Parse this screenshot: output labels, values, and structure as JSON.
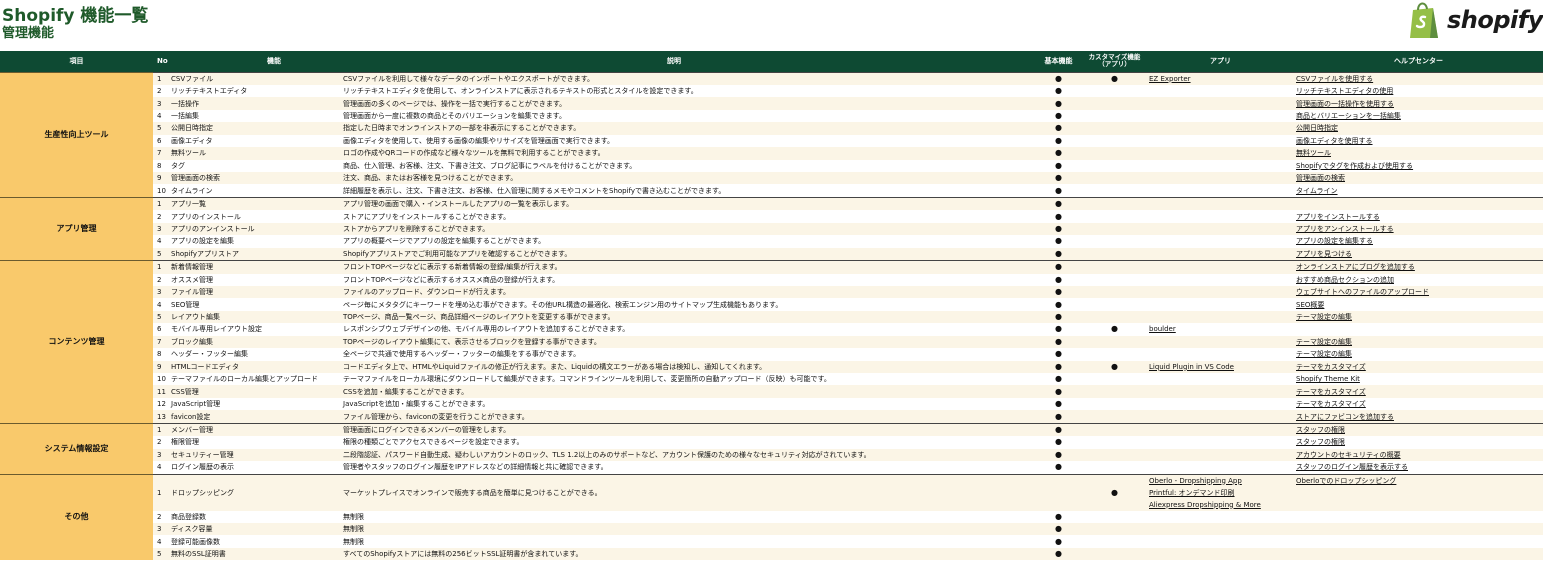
{
  "title": "Shopify 機能一覧",
  "subtitle": "管理機能",
  "logo_text": "shopify",
  "colors": {
    "header_bg": "#0e4a33",
    "category_bg": "#f9c96b",
    "row_alt": "#fbf5e6",
    "title": "#1f5a2a",
    "logo_green": "#95bf47"
  },
  "headers": {
    "category": "項目",
    "no": "No",
    "feature": "機能",
    "description": "説明",
    "basic": "基本機能",
    "custom": "カスタマイズ機能（アプリ）",
    "app": "アプリ",
    "help": "ヘルプセンター"
  },
  "dot": "●",
  "sections": [
    {
      "category": "生産性向上ツール",
      "rows": [
        {
          "no": "1",
          "feature": "CSVファイル",
          "desc": "CSVファイルを利用して様々なデータのインポートやエクスポートができます。",
          "basic": true,
          "custom": true,
          "apps": [
            "EZ Exporter"
          ],
          "help": "CSVファイルを使用する"
        },
        {
          "no": "2",
          "feature": "リッチテキストエディタ",
          "desc": "リッチテキストエディタを使用して、オンラインストアに表示されるテキストの形式とスタイルを設定できます。",
          "basic": true,
          "custom": false,
          "apps": [],
          "help": "リッチテキストエディタの使用"
        },
        {
          "no": "3",
          "feature": "一括操作",
          "desc": "管理画面の多くのページでは、操作を一括で実行することができます。",
          "basic": true,
          "custom": false,
          "apps": [],
          "help": "管理画面の一括操作を使用する"
        },
        {
          "no": "4",
          "feature": "一括編集",
          "desc": "管理画面から一度に複数の商品とそのバリエーションを編集できます。",
          "basic": true,
          "custom": false,
          "apps": [],
          "help": "商品とバリエーションを一括編集"
        },
        {
          "no": "5",
          "feature": "公開日時指定",
          "desc": "指定した日時までオンラインストアの一部を非表示にすることができます。",
          "basic": true,
          "custom": false,
          "apps": [],
          "help": "公開日時指定"
        },
        {
          "no": "6",
          "feature": "画像エディタ",
          "desc": "画像エディタを使用して、使用する画像の編集やリサイズを管理画面で実行できます。",
          "basic": true,
          "custom": false,
          "apps": [],
          "help": "画像エディタを使用する"
        },
        {
          "no": "7",
          "feature": "無料ツール",
          "desc": "ロゴの作成やQRコードの作成など様々なツールを無料で利用することができます。",
          "basic": true,
          "custom": false,
          "apps": [],
          "help": "無料ツール"
        },
        {
          "no": "8",
          "feature": "タグ",
          "desc": "商品、仕入管理、お客様、注文、下書き注文、ブログ記事にラベルを付けることができます。",
          "basic": true,
          "custom": false,
          "apps": [],
          "help": "Shopifyでタグを作成および使用する"
        },
        {
          "no": "9",
          "feature": "管理画面の検索",
          "desc": "注文、商品、またはお客様を見つけることができます。",
          "basic": true,
          "custom": false,
          "apps": [],
          "help": "管理画面の検索"
        },
        {
          "no": "10",
          "feature": "タイムライン",
          "desc": "詳細履歴を表示し、注文、下書き注文、お客様、仕入管理に関するメモやコメントをShopifyで書き込むことができます。",
          "basic": true,
          "custom": false,
          "apps": [],
          "help": "タイムライン"
        }
      ]
    },
    {
      "category": "アプリ管理",
      "rows": [
        {
          "no": "1",
          "feature": "アプリ一覧",
          "desc": "アプリ管理の画面で購入・インストールしたアプリの一覧を表示します。",
          "basic": true,
          "custom": false,
          "apps": [],
          "help": ""
        },
        {
          "no": "2",
          "feature": "アプリのインストール",
          "desc": "ストアにアプリをインストールすることができます。",
          "basic": true,
          "custom": false,
          "apps": [],
          "help": "アプリをインストールする"
        },
        {
          "no": "3",
          "feature": "アプリのアンインストール",
          "desc": "ストアからアプリを削除することができます。",
          "basic": true,
          "custom": false,
          "apps": [],
          "help": "アプリをアンインストールする"
        },
        {
          "no": "4",
          "feature": "アプリの設定を編集",
          "desc": "アプリの概要ページでアプリの設定を編集することができます。",
          "basic": true,
          "custom": false,
          "apps": [],
          "help": "アプリの設定を編集する"
        },
        {
          "no": "5",
          "feature": "Shopifyアプリストア",
          "desc": "Shopifyアプリストアでご利用可能なアプリを確認することができます。",
          "basic": true,
          "custom": false,
          "apps": [],
          "help": "アプリを見つける"
        }
      ]
    },
    {
      "category": "コンテンツ管理",
      "rows": [
        {
          "no": "1",
          "feature": "新着情報管理",
          "desc": "フロントTOPページなどに表示する新着情報の登録/編集が行えます。",
          "basic": true,
          "custom": false,
          "apps": [],
          "help": "オンラインストアにブログを追加する"
        },
        {
          "no": "2",
          "feature": "オススメ管理",
          "desc": "フロントTOPページなどに表示するオススメ商品の登録が行えます。",
          "basic": true,
          "custom": false,
          "apps": [],
          "help": "おすすめ商品セクションの追加"
        },
        {
          "no": "3",
          "feature": "ファイル管理",
          "desc": "ファイルのアップロード、ダウンロードが行えます。",
          "basic": true,
          "custom": false,
          "apps": [],
          "help": "ウェブサイトへのファイルのアップロード"
        },
        {
          "no": "4",
          "feature": "SEO管理",
          "desc": "ページ毎にメタタグにキーワードを埋め込む事ができます。その他URL構造の最適化、検索エンジン用のサイトマップ生成機能もあります。",
          "basic": true,
          "custom": false,
          "apps": [],
          "help": "SEO概要"
        },
        {
          "no": "5",
          "feature": "レイアウト編集",
          "desc": "TOPページ、商品一覧ページ、商品詳細ページのレイアウトを変更する事ができます。",
          "basic": true,
          "custom": false,
          "apps": [],
          "help": "テーマ設定の編集"
        },
        {
          "no": "6",
          "feature": "モバイル専用レイアウト設定",
          "desc": "レスポンシブウェブデザインの他、モバイル専用のレイアウトを追加することができます。",
          "basic": true,
          "custom": true,
          "apps": [
            "boulder"
          ],
          "help": ""
        },
        {
          "no": "7",
          "feature": "ブロック編集",
          "desc": "TOPページのレイアウト編集にて、表示させるブロックを登録する事ができます。",
          "basic": true,
          "custom": false,
          "apps": [],
          "help": "テーマ設定の編集"
        },
        {
          "no": "8",
          "feature": "ヘッダー・フッター編集",
          "desc": "全ページで共通で使用するヘッダー・フッターの編集をする事ができます。",
          "basic": true,
          "custom": false,
          "apps": [],
          "help": "テーマ設定の編集"
        },
        {
          "no": "9",
          "feature": "HTMLコードエディタ",
          "desc": "コードエディタ上で、HTMLやLiquidファイルの修正が行えます。また、Liquidの構文エラーがある場合は検知し、通知してくれます。",
          "basic": true,
          "custom": true,
          "apps": [
            "Liquid Plugin in VS Code"
          ],
          "help": "テーマをカスタマイズ"
        },
        {
          "no": "10",
          "feature": "テーマファイルのローカル編集とアップロード",
          "desc": "テーマファイルをローカル環境にダウンロードして編集ができます。コマンドラインツールを利用して、変更箇所の自動アップロード（反映）も可能です。",
          "basic": true,
          "custom": false,
          "apps": [],
          "help": "Shopify Theme Kit"
        },
        {
          "no": "11",
          "feature": "CSS管理",
          "desc": "CSSを追加・編集することができます。",
          "basic": true,
          "custom": false,
          "apps": [],
          "help": "テーマをカスタマイズ"
        },
        {
          "no": "12",
          "feature": "JavaScript管理",
          "desc": "JavaScriptを追加・編集することができます。",
          "basic": true,
          "custom": false,
          "apps": [],
          "help": "テーマをカスタマイズ"
        },
        {
          "no": "13",
          "feature": "favicon設定",
          "desc": "ファイル管理から、faviconの変更を行うことができます。",
          "basic": true,
          "custom": false,
          "apps": [],
          "help": "ストアにファビコンを追加する"
        }
      ]
    },
    {
      "category": "システム情報設定",
      "rows": [
        {
          "no": "1",
          "feature": "メンバー管理",
          "desc": "管理画面にログインできるメンバーの管理をします。",
          "basic": true,
          "custom": false,
          "apps": [],
          "help": "スタッフの権限"
        },
        {
          "no": "2",
          "feature": "権限管理",
          "desc": "権限の種類ごとでアクセスできるページを設定できます。",
          "basic": true,
          "custom": false,
          "apps": [],
          "help": "スタッフの権限"
        },
        {
          "no": "3",
          "feature": "セキュリティー管理",
          "desc": "二段階認証、パスワード自動生成、疑わしいアカウントのロック、TLS 1.2以上のみのサポートなど、アカウント保護のための様々なセキュリティ対応がされています。",
          "basic": true,
          "custom": false,
          "apps": [],
          "help": "アカウントのセキュリティの概要"
        },
        {
          "no": "4",
          "feature": "ログイン履歴の表示",
          "desc": "管理者やスタッフのログイン履歴をIPアドレスなどの詳細情報と共に確認できます。",
          "basic": true,
          "custom": false,
          "apps": [],
          "help": "スタッフのログイン履歴を表示する"
        }
      ]
    },
    {
      "category": "その他",
      "rows": [
        {
          "no": "1",
          "feature": "ドロップシッピング",
          "desc": "マーケットプレイスでオンラインで販売する商品を簡単に見つけることができる。",
          "basic": false,
          "custom": true,
          "apps": [
            "Oberlo ‑ Dropshipping App",
            "Printful: オンデマンド印刷",
            "Aliexpress Dropshipping & More"
          ],
          "help": "Oberloでのドロップシッピング"
        },
        {
          "no": "2",
          "feature": "商品登録数",
          "desc": "無制限",
          "basic": true,
          "custom": false,
          "apps": [],
          "help": ""
        },
        {
          "no": "3",
          "feature": "ディスク容量",
          "desc": "無制限",
          "basic": true,
          "custom": false,
          "apps": [],
          "help": ""
        },
        {
          "no": "4",
          "feature": "登録可能画像数",
          "desc": "無制限",
          "basic": true,
          "custom": false,
          "apps": [],
          "help": ""
        },
        {
          "no": "5",
          "feature": "無料のSSL証明書",
          "desc": "すべてのShopifyストアには無料の256ビットSSL証明書が含まれています。",
          "basic": true,
          "custom": false,
          "apps": [],
          "help": ""
        }
      ]
    }
  ]
}
